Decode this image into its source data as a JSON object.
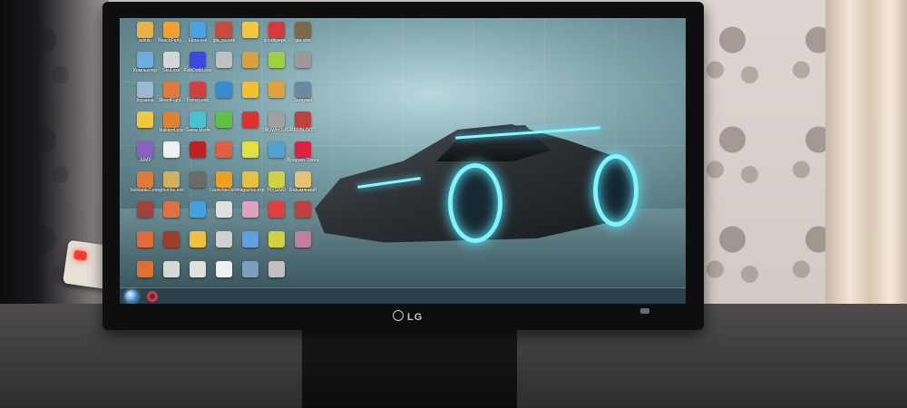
{
  "monitor": {
    "brand": "LG"
  },
  "desktop": {
    "icons": [
      {
        "label": "admin",
        "color": "#e8b24a"
      },
      {
        "label": "BeachParty...",
        "color": "#f0a030"
      },
      {
        "label": "Elma.exe",
        "color": "#4aa0e0"
      },
      {
        "label": "gta_sa.exe",
        "color": "#c84a3a"
      },
      {
        "label": "",
        "color": "#f2c840"
      },
      {
        "label": "goodbyepe...",
        "color": "#d43a3a"
      },
      {
        "label": "gta-vibe",
        "color": "#7a6a4a"
      },
      {
        "label": "Компьютер",
        "color": "#6aaee0"
      },
      {
        "label": "Skul.exe",
        "color": "#d6d6d6"
      },
      {
        "label": "FishDotbl.exe",
        "color": "#3a4ae0"
      },
      {
        "label": "",
        "color": "#c0c0c0"
      },
      {
        "label": "",
        "color": "#d8a040"
      },
      {
        "label": "",
        "color": "#a0d040"
      },
      {
        "label": "",
        "color": "#9a9a9a"
      },
      {
        "label": "Корзина",
        "color": "#9ab8d0"
      },
      {
        "label": "StreetFight...",
        "color": "#e07a3a"
      },
      {
        "label": "Frenzy.exe",
        "color": "#d04040"
      },
      {
        "label": "",
        "color": "#3a8ad0"
      },
      {
        "label": "",
        "color": "#f0c030"
      },
      {
        "label": "",
        "color": "#e0a040"
      },
      {
        "label": "Загрузки",
        "color": "#6a8aa0"
      },
      {
        "label": "",
        "color": "#f2c840"
      },
      {
        "label": "builder4.exe",
        "color": "#e08030"
      },
      {
        "label": "Game Mode",
        "color": "#4ac0d0"
      },
      {
        "label": "",
        "color": "#60c040"
      },
      {
        "label": "",
        "color": "#e03030"
      },
      {
        "label": "SNOWHOUSE",
        "color": "#a0a0a0"
      },
      {
        "label": "REDBLOOD",
        "color": "#c04040"
      },
      {
        "label": "JUMP",
        "color": "#8a60c0"
      },
      {
        "label": "",
        "color": "#f0f0f0"
      },
      {
        "label": "",
        "color": "#c02020"
      },
      {
        "label": "",
        "color": "#e06040"
      },
      {
        "label": "",
        "color": "#e0e040"
      },
      {
        "label": "",
        "color": "#50a0d0"
      },
      {
        "label": "Браузер Opera",
        "color": "#e02040"
      },
      {
        "label": "buildable2.exe",
        "color": "#e07a3a"
      },
      {
        "label": "gdumbo.exe",
        "color": "#d0b060"
      },
      {
        "label": "",
        "color": "#6a6a6a"
      },
      {
        "label": "LauncherJunk",
        "color": "#f0a020"
      },
      {
        "label": "magazine.exe",
        "color": "#e8c040"
      },
      {
        "label": "PIXSIMO",
        "color": "#d0d040"
      },
      {
        "label": "Безымянный",
        "color": "#e8c070"
      },
      {
        "label": "",
        "color": "#a04040"
      },
      {
        "label": "",
        "color": "#e07040"
      },
      {
        "label": "",
        "color": "#40a0e0"
      },
      {
        "label": "",
        "color": "#e0e0e0"
      },
      {
        "label": "",
        "color": "#e0a0c0"
      },
      {
        "label": "",
        "color": "#e04040"
      },
      {
        "label": "",
        "color": "#c04040"
      },
      {
        "label": "",
        "color": "#e06a3a"
      },
      {
        "label": "",
        "color": "#a03a2a"
      },
      {
        "label": "",
        "color": "#f0c040"
      },
      {
        "label": "",
        "color": "#d0d0d0"
      },
      {
        "label": "",
        "color": "#60a0e0"
      },
      {
        "label": "",
        "color": "#d0d040"
      },
      {
        "label": "",
        "color": "#c080a0"
      },
      {
        "label": "",
        "color": "#e07030"
      },
      {
        "label": "",
        "color": "#d8d8d8"
      },
      {
        "label": "",
        "color": "#e0e0e0"
      },
      {
        "label": "",
        "color": "#f0f0f0"
      },
      {
        "label": "",
        "color": "#7aa0c0"
      },
      {
        "label": "",
        "color": "#c0c0c0"
      }
    ]
  },
  "taskbar": {
    "tray_time": "",
    "tray_date": ""
  },
  "palette": {
    "neon": "#7ff4ff",
    "led": "#ff3a2a"
  }
}
